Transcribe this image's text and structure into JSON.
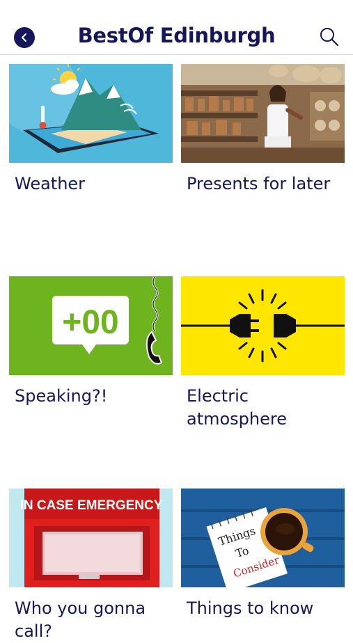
{
  "header": {
    "title": "BestOf Edinburgh",
    "back_icon": "chevron-left-icon",
    "search_icon": "search-icon"
  },
  "tiles": [
    {
      "label": "Weather",
      "image": "weather-tablet-illustration"
    },
    {
      "label": "Presents for later",
      "image": "market-shop-photo"
    },
    {
      "label": "Speaking?!",
      "image": "phone-dial-code-illustration"
    },
    {
      "label": "Electric atmosphere",
      "image": "plug-socket-illustration"
    },
    {
      "label": "Who you gonna call?",
      "image": "emergency-box-photo",
      "image_text": "IN CASE EMERGENCY"
    },
    {
      "label": "Things to know",
      "image": "coffee-note-photo",
      "image_text": [
        "Things",
        "To",
        "Consider"
      ]
    }
  ],
  "colors": {
    "brand": "#16175b",
    "weather_bg": "#4fb7d9",
    "speaking_bg": "#6db41f",
    "electric_bg": "#ffe600",
    "emergency_bg": "#bfe8f0",
    "emergency_red": "#e0201e",
    "things_bg": "#1f5f9e"
  },
  "speaking_sign": "+00"
}
